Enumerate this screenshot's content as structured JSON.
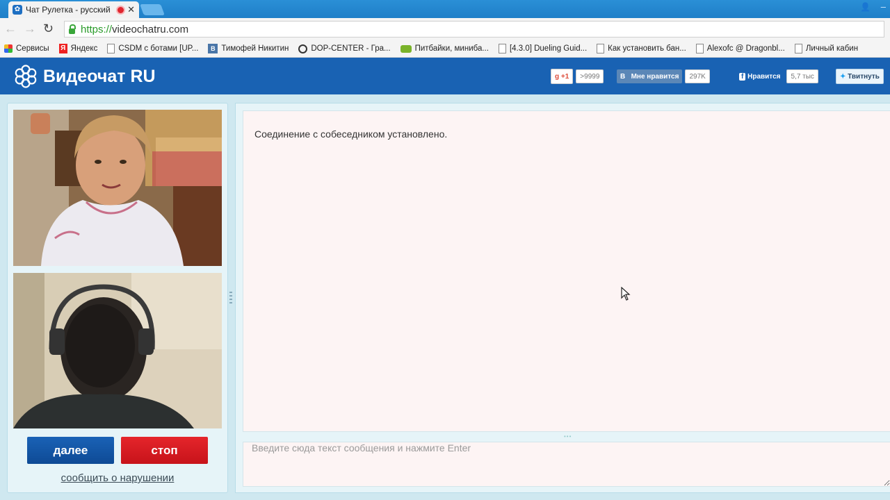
{
  "browser": {
    "tab_title": "Чат Рулетка - русский",
    "url_scheme": "https://",
    "url_host": "videochatru.com",
    "bookmarks": [
      {
        "label": "Сервисы",
        "icon": "apps-icon"
      },
      {
        "label": "Яндекс",
        "icon": "yandex-icon"
      },
      {
        "label": "CSDM с ботами [UP...",
        "icon": "page-icon"
      },
      {
        "label": "Тимофей Никитин",
        "icon": "vk-icon"
      },
      {
        "label": "DOP-CENTER - Гра...",
        "icon": "steering-wheel-icon"
      },
      {
        "label": "Питбайки, миниба...",
        "icon": "moto-icon"
      },
      {
        "label": "[4.3.0] Dueling Guid...",
        "icon": "page-icon"
      },
      {
        "label": "Как установить бан...",
        "icon": "page-icon"
      },
      {
        "label": "Alexofc @ Dragonbl...",
        "icon": "page-icon"
      },
      {
        "label": "Личный кабин",
        "icon": "page-icon"
      }
    ]
  },
  "site": {
    "logo_text": "Видеочат RU",
    "social": {
      "gplus_label": "+1",
      "gplus_count": ">9999",
      "vk_label": "Мне нравится",
      "vk_count": "297K",
      "fb_label": "Нравится",
      "fb_count": "5,7 тыс",
      "tw_label": "Твитнуть"
    }
  },
  "controls": {
    "next_label": "далее",
    "stop_label": "стоп",
    "report_label": "сообщить о нарушении"
  },
  "chat": {
    "messages": [
      "Соединение с собеседником установлено."
    ],
    "input_placeholder": "Введите сюда текст сообщения и нажмите Enter"
  },
  "colors": {
    "header_bg": "#1962b3",
    "next_button": "#1a62b6",
    "stop_button": "#e5252b",
    "chat_bg": "#fdf4f4"
  }
}
